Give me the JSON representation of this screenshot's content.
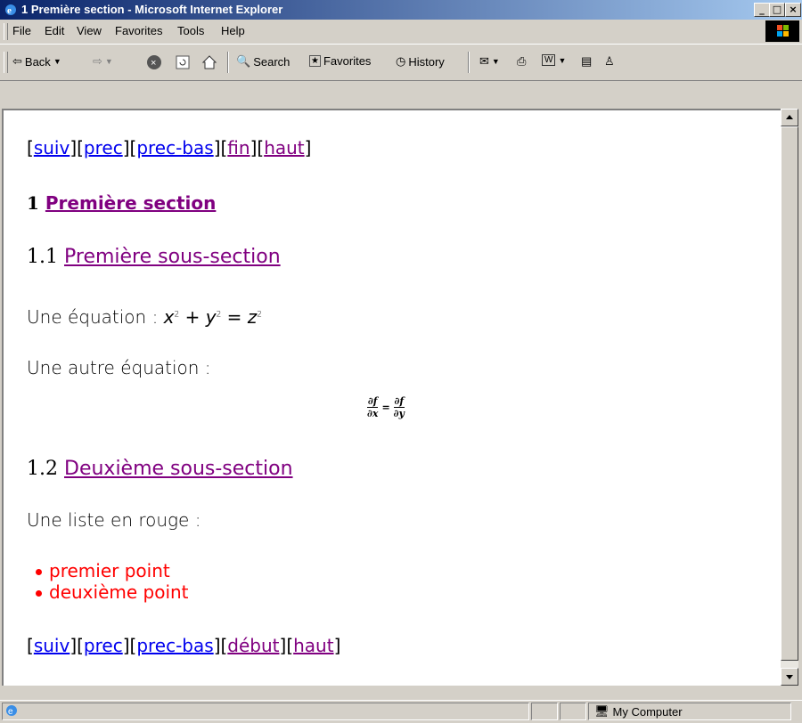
{
  "window": {
    "title": "1 Première section - Microsoft Internet Explorer"
  },
  "menu": [
    "File",
    "Edit",
    "View",
    "Favorites",
    "Tools",
    "Help"
  ],
  "toolbar": {
    "back": "Back",
    "search": "Search",
    "favorites": "Favorites",
    "history": "History"
  },
  "page": {
    "nav_top": {
      "l1": "suiv",
      "l2": "prec",
      "l3": "prec-bas",
      "l4": "fin",
      "l5": "haut"
    },
    "section": {
      "number": "1",
      "title": "Première section"
    },
    "subsection1": {
      "number": "1.1",
      "title": "Première sous-section"
    },
    "equation_label": "Une équation : ",
    "equation": {
      "a": "x",
      "b": "y",
      "c": "z",
      "exp": "2"
    },
    "equation2_label": "Une autre équation :",
    "eq2": {
      "num": "∂f",
      "den_left": "∂x",
      "den_right": "∂y",
      "eq": "="
    },
    "subsection2": {
      "number": "1.2",
      "title": "Deuxième sous-section"
    },
    "list_label": "Une liste en rouge :",
    "list_items": [
      "premier point",
      "deuxième point"
    ],
    "nav_bottom": {
      "l1": "suiv",
      "l2": "prec",
      "l3": "prec-bas",
      "l4": "début",
      "l5": "haut"
    }
  },
  "status": {
    "zone": "My Computer"
  },
  "colors": {
    "link": "#0000ee",
    "visited": "#800080",
    "red_list": "#ff0000",
    "titlebar": "#0a246a"
  }
}
